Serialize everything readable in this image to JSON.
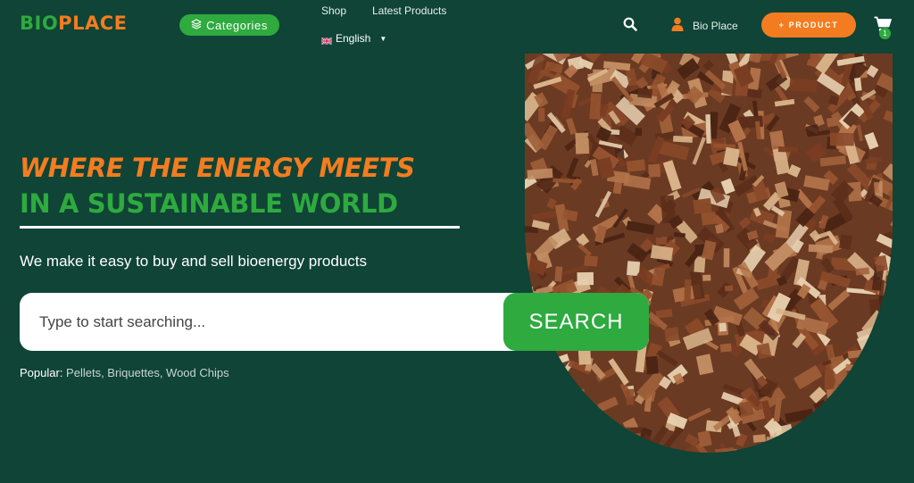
{
  "header": {
    "logo_part1": "BIO",
    "logo_part2": "PLACE",
    "categories_label": "Categories",
    "nav": [
      {
        "label": "Shop"
      },
      {
        "label": "Latest Products"
      }
    ],
    "language": "English",
    "user_name": "Bio Place",
    "add_product_label": "+ PRODUCT",
    "cart_count": "1"
  },
  "hero": {
    "headline_line1": "WHERE THE ENERGY MEETS",
    "headline_line2": "IN A SUSTAINABLE WORLD",
    "tagline": "We make it easy to buy and sell bioenergy products",
    "search_placeholder": "Type to start searching...",
    "search_button": "SEARCH",
    "popular_label": "Popular:",
    "popular_items": "Pellets, Briquettes, Wood Chips"
  },
  "colors": {
    "background": "#0f4436",
    "brand_green": "#2eaa3f",
    "brand_orange": "#f47c20"
  },
  "icons": {
    "categories": "layers-icon",
    "search": "search-icon",
    "user": "user-icon",
    "cart": "cart-icon",
    "flag": "uk-flag-icon",
    "caret": "caret-down-icon"
  }
}
